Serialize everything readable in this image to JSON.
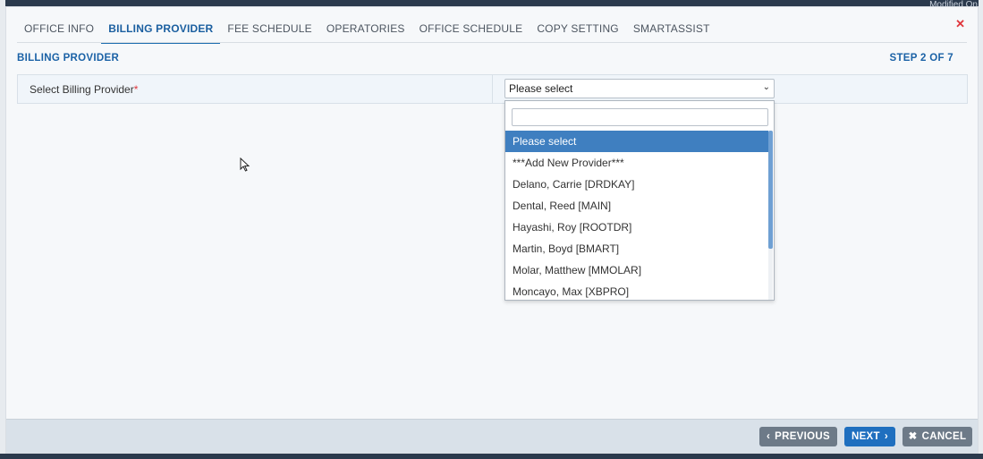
{
  "background": {
    "corner_text": "Modified On"
  },
  "modal": {
    "close_icon": "close-icon",
    "tabs": [
      {
        "label": "OFFICE INFO",
        "active": false
      },
      {
        "label": "BILLING PROVIDER",
        "active": true
      },
      {
        "label": "FEE SCHEDULE",
        "active": false
      },
      {
        "label": "OPERATORIES",
        "active": false
      },
      {
        "label": "OFFICE SCHEDULE",
        "active": false
      },
      {
        "label": "COPY SETTING",
        "active": false
      },
      {
        "label": "SMARTASSIST",
        "active": false
      }
    ],
    "section_title": "BILLING PROVIDER",
    "step": "STEP 2 OF 7",
    "form": {
      "label": "Select Billing Provider",
      "required_mark": "*",
      "select_value": "Please select",
      "search_value": "",
      "options": [
        {
          "label": "Please select",
          "selected": true
        },
        {
          "label": "***Add New Provider***",
          "selected": false
        },
        {
          "label": "Delano, Carrie [DRDKAY]",
          "selected": false
        },
        {
          "label": "Dental, Reed [MAIN]",
          "selected": false
        },
        {
          "label": "Hayashi, Roy [ROOTDR]",
          "selected": false
        },
        {
          "label": "Martin, Boyd [BMART]",
          "selected": false
        },
        {
          "label": "Molar, Matthew [MMOLAR]",
          "selected": false
        },
        {
          "label": "Moncayo, Max [XBPRO]",
          "selected": false
        }
      ]
    },
    "footer": {
      "previous_label": "PREVIOUS",
      "next_label": "NEXT",
      "cancel_label": "CANCEL"
    }
  },
  "colors": {
    "accent": "#1b62a6",
    "selected_option": "#3f7fc0",
    "next_button": "#1f6fbf",
    "secondary_button": "#6d7a88",
    "close": "#e0363c"
  }
}
